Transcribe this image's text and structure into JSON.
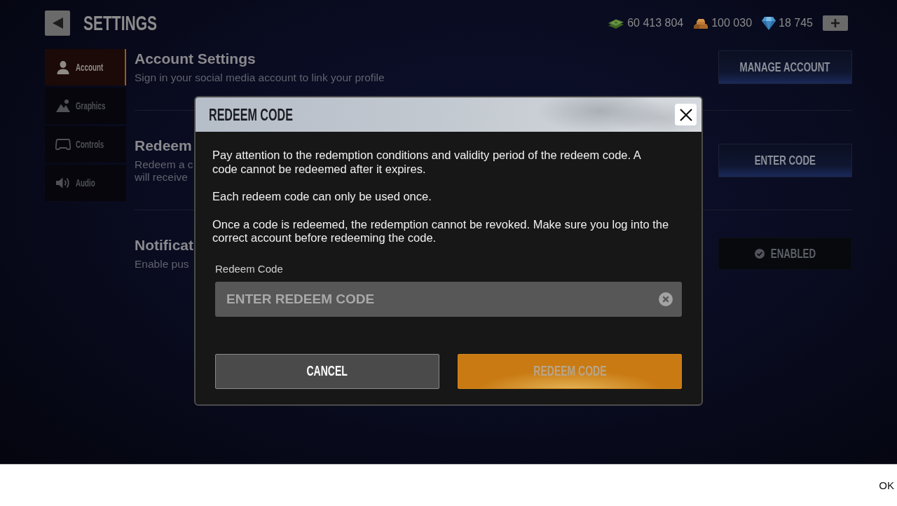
{
  "header": {
    "title": "SETTINGS",
    "currencies": [
      {
        "kind": "cash",
        "amount": "60 413 804"
      },
      {
        "kind": "gold",
        "amount": "100 030"
      },
      {
        "kind": "gems",
        "amount": "18 745"
      }
    ]
  },
  "sidebar": {
    "items": [
      {
        "kind": "account",
        "label": "Account",
        "selected": true
      },
      {
        "kind": "graphics",
        "label": "Graphics",
        "selected": false
      },
      {
        "kind": "controls",
        "label": "Controls",
        "selected": false
      },
      {
        "kind": "audio",
        "label": "Audio",
        "selected": false
      }
    ]
  },
  "sections": [
    {
      "title": "Account Settings",
      "description": [
        "Sign in your social media account to link your profile"
      ],
      "button": {
        "kind": "action",
        "label": "MANAGE ACCOUNT"
      }
    },
    {
      "title": "Redeem",
      "description": [
        "Redeem a c",
        "will receive"
      ],
      "button": {
        "kind": "action",
        "label": "ENTER CODE"
      }
    },
    {
      "title": "Notificat",
      "description": [
        "Enable pus"
      ],
      "button": {
        "kind": "toggle",
        "label": "ENABLED",
        "on": true
      }
    }
  ],
  "modal": {
    "title": "REDEEM CODE",
    "paragraphs": [
      "Pay attention to the redemption conditions and validity period of the redeem code. A code cannot be redeemed after it expires.",
      "Each redeem code can only be used once.",
      "Once a code is redeemed, the redemption cannot be revoked. Make sure you log into the correct account before redeeming the code."
    ],
    "field": {
      "label": "Redeem Code",
      "placeholder": "ENTER REDEEM CODE"
    },
    "buttons": [
      {
        "kind": "secondary",
        "label": "CANCEL",
        "disabled": false
      },
      {
        "kind": "primary",
        "label": "REDEEM CODE",
        "disabled": true
      }
    ]
  },
  "bottom_bar": {
    "button": "OK"
  }
}
